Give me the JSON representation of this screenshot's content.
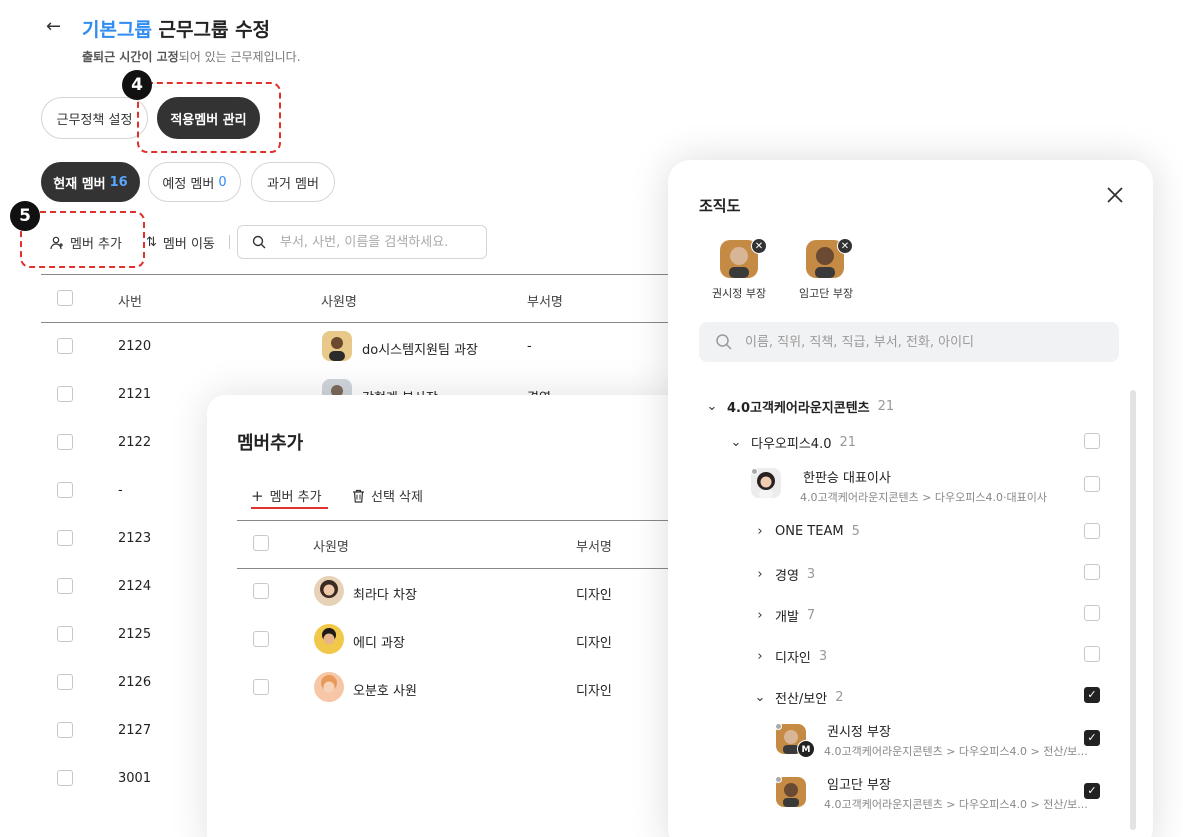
{
  "header": {
    "back_icon": "arrow-left-icon",
    "title_group": "기본그룹",
    "title_rest": "근무그룹 수정",
    "subtitle_bold": "출퇴근 시간이 고정",
    "subtitle_rest": "되어 있는 근무제입니다."
  },
  "tabs": [
    {
      "label": "근무정책 설정"
    },
    {
      "label": "적용멤버 관리"
    }
  ],
  "member_tabs": [
    {
      "label": "현재 멤버",
      "count": "16"
    },
    {
      "label": "예정 멤버",
      "count": "0"
    },
    {
      "label": "과거 멤버",
      "count": ""
    }
  ],
  "steps": {
    "four": "4",
    "five": "5"
  },
  "toolbar": {
    "add_member": "멤버 추가",
    "move_member": "멤버 이동",
    "search_placeholder": "부서, 사번, 이름을 검색하세요."
  },
  "table": {
    "headers": [
      "사번",
      "사원명",
      "부서명"
    ],
    "rows": [
      {
        "id": "2120",
        "name": "do시스템지원팀 과장",
        "dept": "-"
      },
      {
        "id": "2121",
        "name": "강형계 부사장",
        "dept": "경영"
      },
      {
        "id": "2122",
        "name": "",
        "dept": ""
      },
      {
        "id": "-",
        "name": "",
        "dept": ""
      },
      {
        "id": "2123",
        "name": "",
        "dept": ""
      },
      {
        "id": "2124",
        "name": "",
        "dept": ""
      },
      {
        "id": "2125",
        "name": "",
        "dept": ""
      },
      {
        "id": "2126",
        "name": "",
        "dept": ""
      },
      {
        "id": "2127",
        "name": "",
        "dept": ""
      },
      {
        "id": "3001",
        "name": "",
        "dept": ""
      }
    ]
  },
  "add_modal": {
    "title": "멤버추가",
    "add_tab": "멤버 추가",
    "delete_tab": "선택 삭제",
    "headers": [
      "사원명",
      "부서명"
    ],
    "rows": [
      {
        "name": "최라다 차장",
        "dept": "디자인"
      },
      {
        "name": "에디 과장",
        "dept": "디자인"
      },
      {
        "name": "오분호 사원",
        "dept": "디자인"
      }
    ]
  },
  "org_modal": {
    "title": "조직도",
    "selected": [
      {
        "name": "권시정 부장"
      },
      {
        "name": "임고단 부장"
      }
    ],
    "search_placeholder": "이름, 직위, 직책, 직급, 부서, 전화, 아이디",
    "root": {
      "label": "4.0고객케어라운지콘텐츠",
      "count": "21"
    },
    "sub": {
      "label": "다우오피스4.0",
      "count": "21"
    },
    "ceo": {
      "name": "한판승 대표이사",
      "path": "4.0고객케어라운지콘텐츠 > 다우오피스4.0·대표이사"
    },
    "groups": [
      {
        "label": "ONE TEAM",
        "count": "5"
      },
      {
        "label": "경영",
        "count": "3"
      },
      {
        "label": "개발",
        "count": "7"
      },
      {
        "label": "디자인",
        "count": "3"
      }
    ],
    "security": {
      "label": "전산/보안",
      "count": "2"
    },
    "members": [
      {
        "name": "권시정 부장",
        "path": "4.0고객케어라운지콘텐츠 > 다우오피스4.0 > 전산/보...",
        "badge": "M"
      },
      {
        "name": "임고단 부장",
        "path": "4.0고객케어라운지콘텐츠 > 다우오피스4.0 > 전산/보...",
        "badge": ""
      }
    ]
  },
  "colors": {
    "accent": "#2f8cf0",
    "dash": "#e0322d",
    "dark": "#333333"
  }
}
